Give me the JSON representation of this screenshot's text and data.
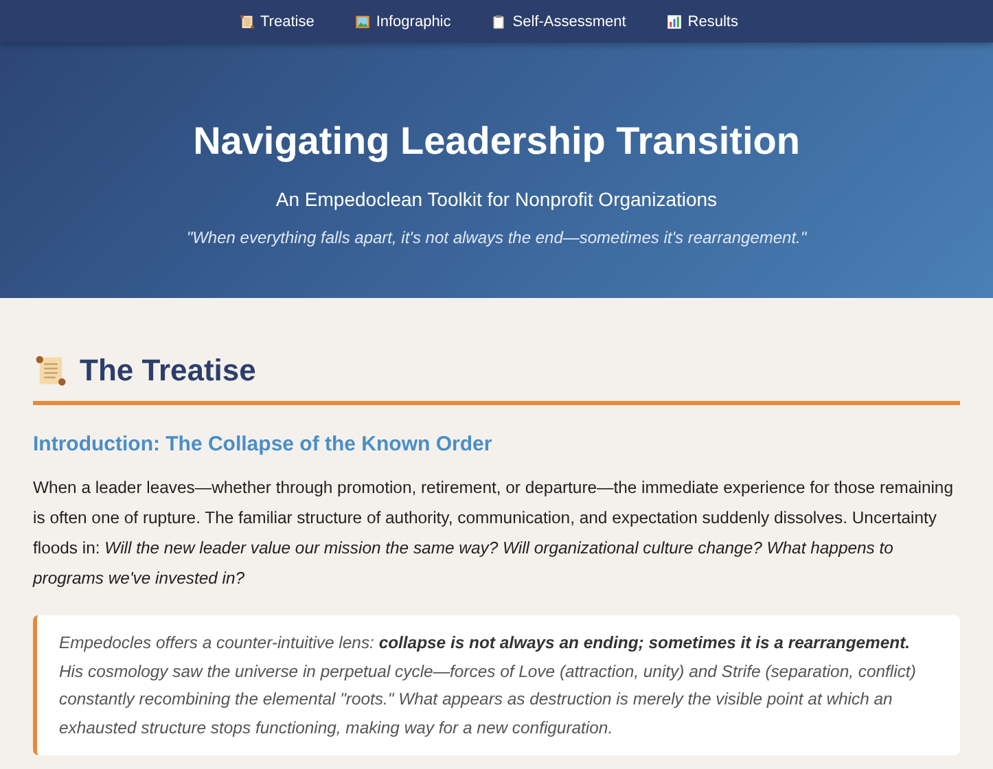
{
  "nav": [
    {
      "label": "Treatise"
    },
    {
      "label": "Infographic"
    },
    {
      "label": "Self-Assessment"
    },
    {
      "label": "Results"
    }
  ],
  "hero": {
    "title": "Navigating Leadership Transition",
    "subtitle": "An Empedoclean Toolkit for Nonprofit Organizations",
    "quote": "\"When everything falls apart, it's not always the end—sometimes it's rearrangement.\""
  },
  "section": {
    "title": "The Treatise",
    "heading": "Introduction: The Collapse of the Known Order",
    "paragraph": "When a leader leaves—whether through promotion, retirement, or departure—the immediate experience for those remaining is often one of rupture. The familiar structure of authority, communication, and expectation suddenly dissolves. Uncertainty floods in: *Will the new leader value our mission the same way? Will organizational culture change? What happens to programs we've invested in?*",
    "callout": "Empedocles offers a counter-intuitive lens: **collapse is not always an ending; sometimes it is a rearrangement.** His cosmology saw the universe in perpetual cycle—forces of Love (attraction, unity) and Strife (separation, conflict) constantly recombining the elemental \"roots.\" What appears as destruction is merely the visible point at which an exhausted structure stops functioning, making way for a new configuration."
  }
}
